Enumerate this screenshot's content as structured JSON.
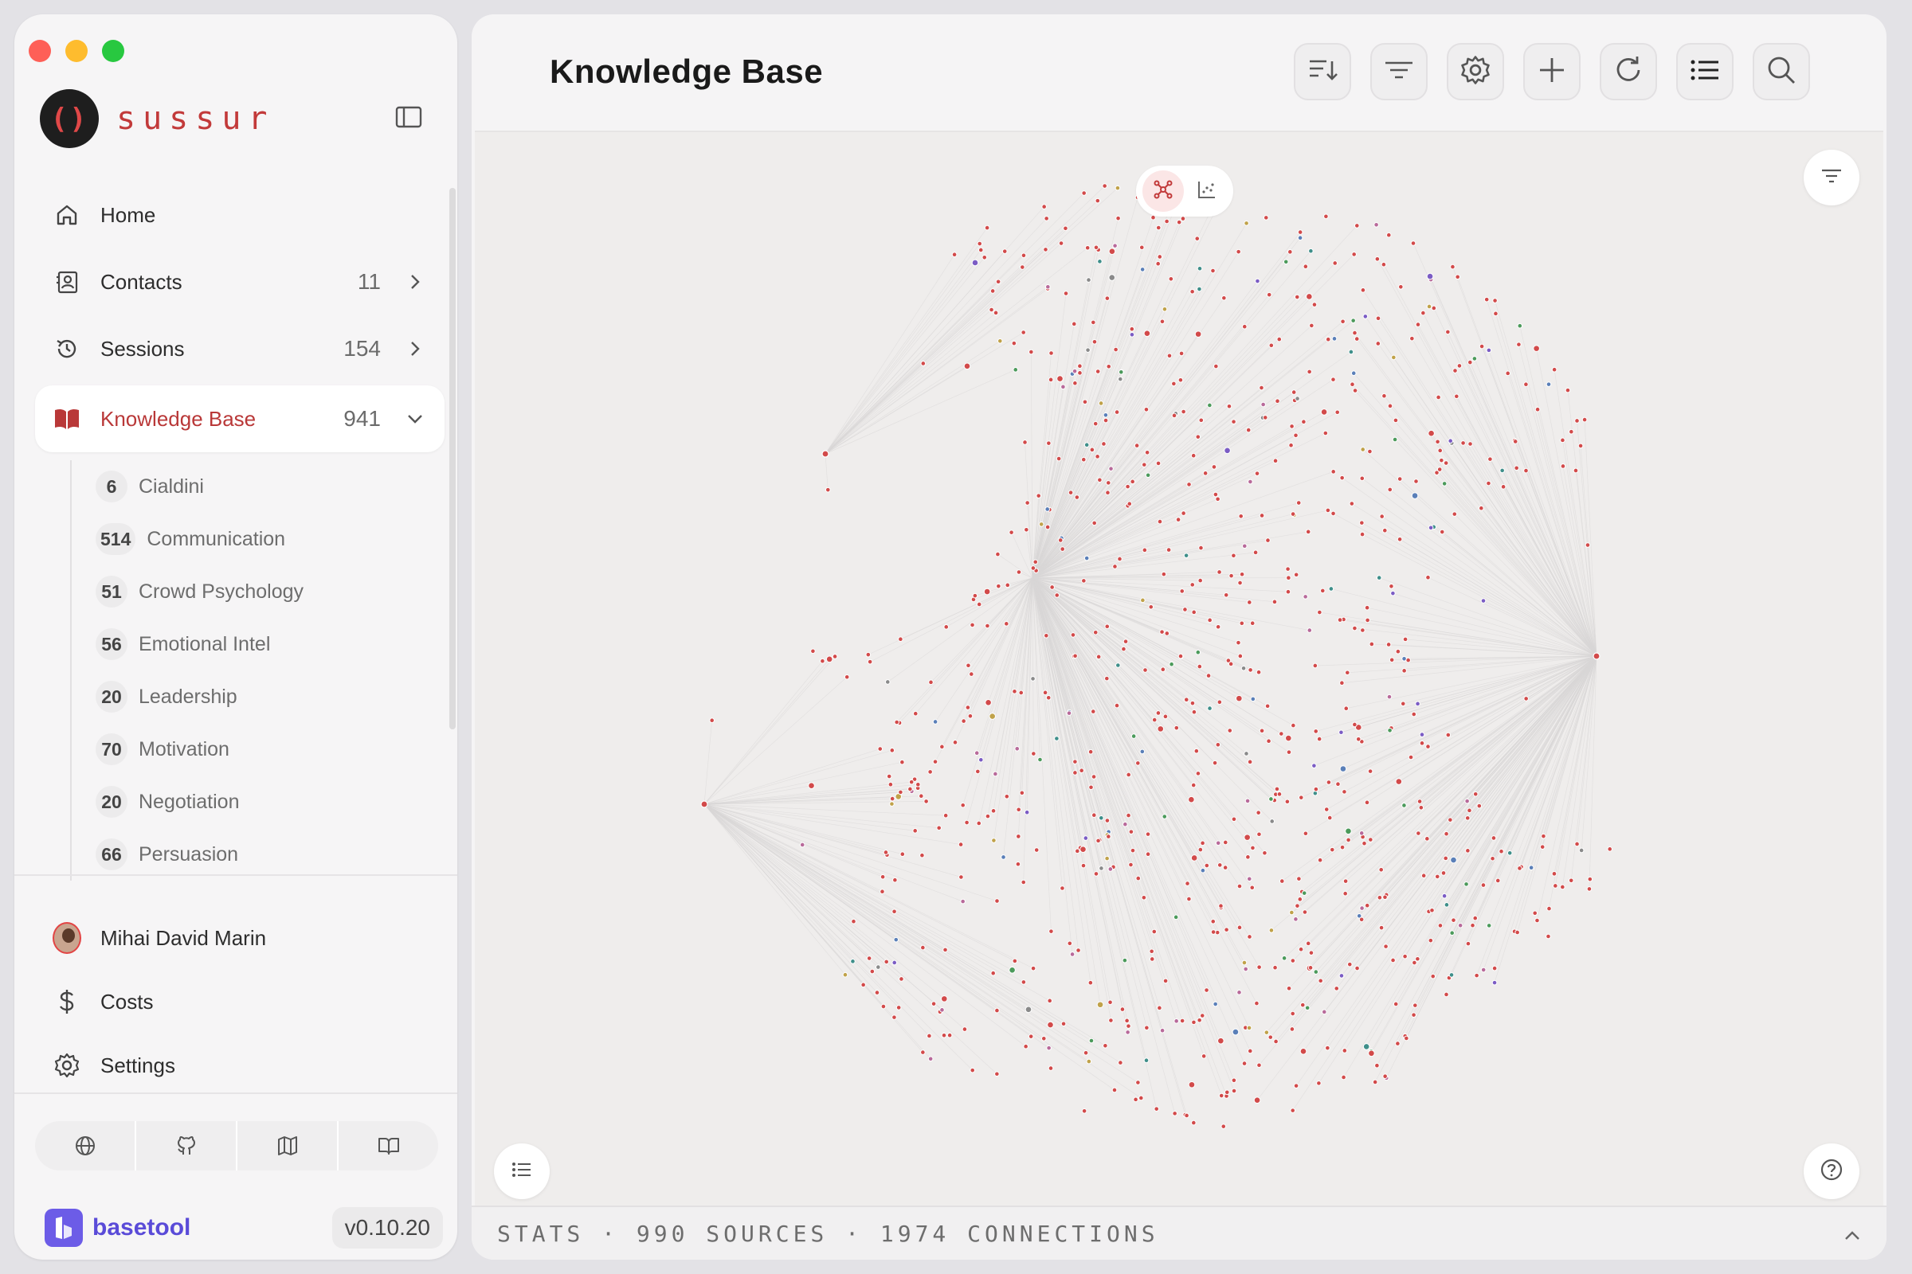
{
  "brand": {
    "logo_text": "()",
    "name": "sussur"
  },
  "nav": [
    {
      "id": "home",
      "label": "Home",
      "icon": "home-icon"
    },
    {
      "id": "contacts",
      "label": "Contacts",
      "count": "11",
      "icon": "contacts-icon"
    },
    {
      "id": "sessions",
      "label": "Sessions",
      "count": "154",
      "icon": "history-icon"
    },
    {
      "id": "knowledge-base",
      "label": "Knowledge Base",
      "count": "941",
      "icon": "book-icon",
      "active": true
    }
  ],
  "kb_categories": [
    {
      "count": "6",
      "label": "Cialdini"
    },
    {
      "count": "514",
      "label": "Communication"
    },
    {
      "count": "51",
      "label": "Crowd Psychology"
    },
    {
      "count": "56",
      "label": "Emotional Intel"
    },
    {
      "count": "20",
      "label": "Leadership"
    },
    {
      "count": "70",
      "label": "Motivation"
    },
    {
      "count": "20",
      "label": "Negotiation"
    },
    {
      "count": "66",
      "label": "Persuasion"
    }
  ],
  "footer": {
    "user_name": "Mihai David Marin",
    "costs_label": "Costs",
    "settings_label": "Settings",
    "icon_bar": [
      "globe-icon",
      "github-icon",
      "map-icon",
      "book-open-icon"
    ]
  },
  "bottom_brand": {
    "name": "basetool",
    "version": "v0.10.20"
  },
  "main": {
    "title": "Knowledge Base",
    "toolbar": [
      "sort-icon",
      "filter-icon",
      "gear-icon",
      "plus-icon",
      "refresh-icon",
      "list-icon",
      "search-icon"
    ],
    "stats_text": "STATS · 990 SOURCES · 1974 CONNECTIONS"
  },
  "colors": {
    "accent": "#c23a3a",
    "node_primary": "#d24a4a",
    "node_palette": [
      "#d24a4a",
      "#3f8f8a",
      "#7b5cc4",
      "#c0a24a",
      "#5a7fb8",
      "#4c9a5b",
      "#b86a9a",
      "#8a8a8a"
    ],
    "edge": "#d8d6d6"
  }
}
